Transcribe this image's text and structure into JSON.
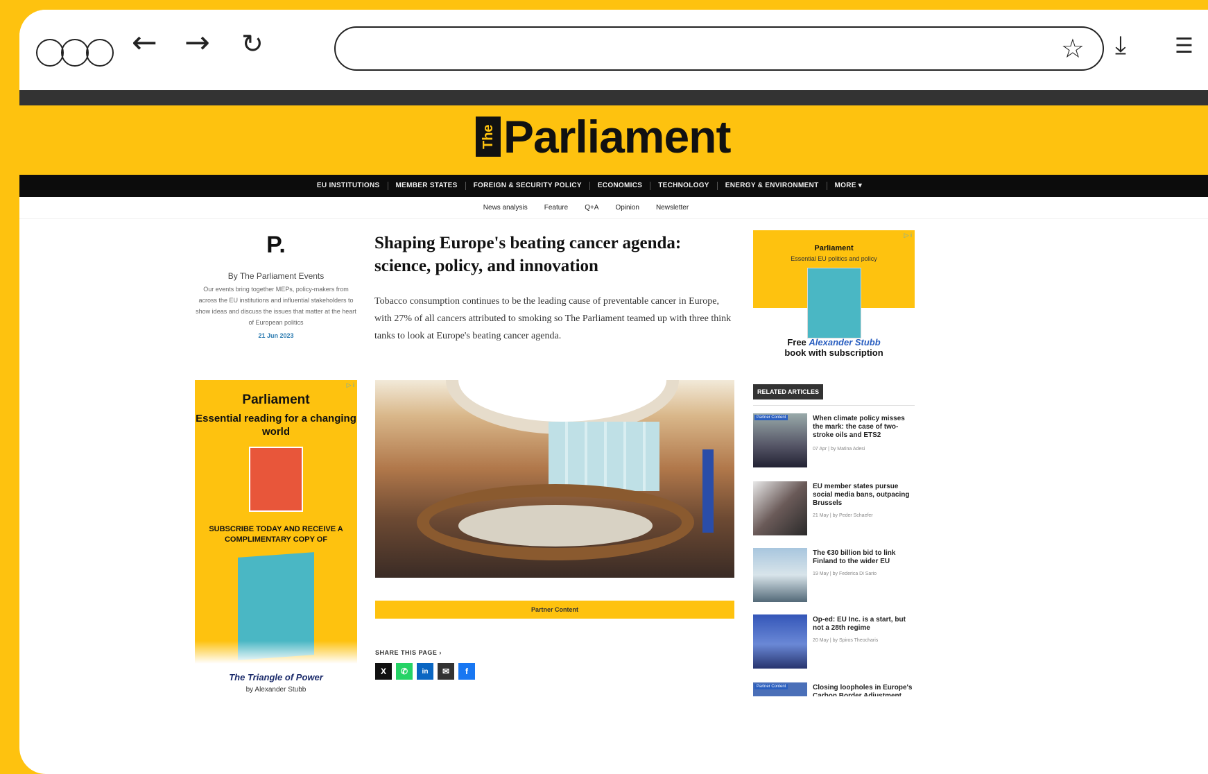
{
  "browser": {
    "url": "",
    "star_icon": "star-icon",
    "download_icon": "download-icon",
    "menu_icon": "menu-icon"
  },
  "site": {
    "logo_the": "The",
    "logo_word": "Parliament",
    "main_nav": [
      "EU INSTITUTIONS",
      "MEMBER STATES",
      "FOREIGN & SECURITY POLICY",
      "ECONOMICS",
      "TECHNOLOGY",
      "ENERGY & ENVIRONMENT",
      "MORE ▾"
    ],
    "sub_nav": [
      "News analysis",
      "Feature",
      "Q+A",
      "Opinion",
      "Newsletter"
    ]
  },
  "author": {
    "logo": "P.",
    "name": "By The Parliament Events",
    "description": "Our events bring together MEPs, policy-makers from across the EU institutions and influential stakeholders to show ideas and discuss the issues that matter at the heart of European politics",
    "date": "21 Jun 2023"
  },
  "article": {
    "headline": "Shaping Europe's beating cancer agenda: science, policy, and innovation",
    "lede": "Tobacco consumption continues to be the leading cause of preventable cancer in Europe, with 27% of all cancers attributed to smoking so The Parliament teamed up with three think tanks to look at Europe's beating cancer agenda.",
    "partner_label": "Partner Content",
    "share_label": "SHARE THIS PAGE",
    "share_icons": [
      "x-icon",
      "whatsapp-icon",
      "linkedin-icon",
      "email-icon",
      "facebook-icon"
    ]
  },
  "ad_left": {
    "brand": "Parliament",
    "tagline": "Essential reading for a changing world",
    "promo": "SUBSCRIBE TODAY AND RECEIVE A COMPLIMENTARY COPY OF",
    "book_title": "The Triangle of Power",
    "book_author": "by Alexander Stubb"
  },
  "ad_right": {
    "brand": "Parliament",
    "tagline": "Essential EU politics and policy",
    "offer_prefix": "Free ",
    "offer_name": "Alexander Stubb",
    "offer_suffix": "book with subscription"
  },
  "related": {
    "label": "RELATED ARTICLES",
    "items": [
      {
        "badge": "Partner Content",
        "title": "When climate policy misses the mark: the case of two-stroke oils and ETS2",
        "meta": "07 Apr | by Matina Adesi"
      },
      {
        "badge": "",
        "title": "EU member states pursue social media bans, outpacing Brussels",
        "meta": "21 May | by Peder Schaefer"
      },
      {
        "badge": "",
        "title": "The €30 billion bid to link Finland to the wider EU",
        "meta": "19 May | by Federica Di Sario"
      },
      {
        "badge": "",
        "title": "Op-ed: EU Inc. is a start, but not a 28th regime",
        "meta": "20 May | by Spiros Theocharis"
      },
      {
        "badge": "Partner Content",
        "title": "Closing loopholes in Europe's Carbon Border Adjustment Mechanism for",
        "meta": ""
      }
    ]
  }
}
